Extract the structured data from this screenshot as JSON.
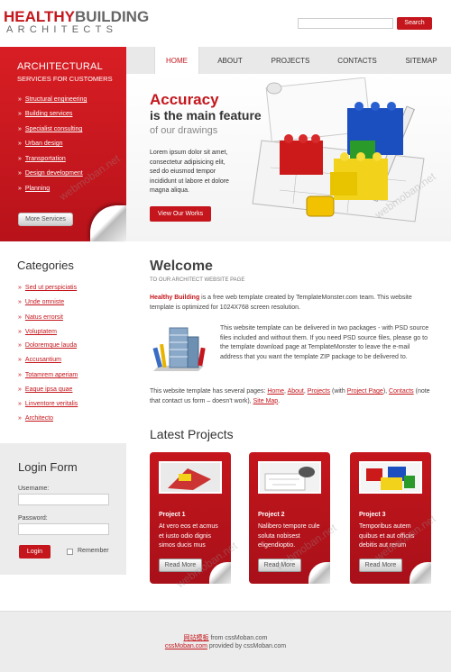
{
  "header": {
    "logo_red": "HEALTHY",
    "logo_grey": "BUILDING",
    "logo_sub": "ARCHITECTS",
    "search_button": "Search",
    "search_value": ""
  },
  "nav": [
    "HOME",
    "ABOUT",
    "PROJECTS",
    "CONTACTS",
    "SITEMAP"
  ],
  "services": {
    "title": "ARCHITECTURAL",
    "subtitle": "SERVICES FOR CUSTOMERS",
    "items": [
      "Structural engineering",
      "Building services",
      "Specialist consulting",
      "Urban design",
      "Transportation",
      "Design development",
      "Planning"
    ],
    "button": "More Services"
  },
  "banner": {
    "line1": "Accuracy",
    "line2": "is the main feature",
    "line3": "of our drawings",
    "text": "Lorem ipsum dolor sit amet, consectetur adipisicing elit, sed do eiusmod tempor incididunt ut labore et dolore magna aliqua.",
    "button": "View Our Works"
  },
  "categories": {
    "title": "Categories",
    "items": [
      "Sed ut perspiciatis",
      "Unde omniste",
      "Natus errorsit",
      "Voluptatem",
      "Doloremque lauda",
      "Accusantium",
      "Totamrem aperiam",
      "Eaque ipsa quae",
      "Linventore veritalis",
      "Architecto"
    ]
  },
  "login": {
    "title": "Login Form",
    "username_label": "Username:",
    "password_label": "Password:",
    "button": "Login",
    "remember": "Remember"
  },
  "welcome": {
    "title": "Welcome",
    "subtitle": "TO OUR ARCHITECT WEBSITE PAGE",
    "p1_bold": "Healthy Building",
    "p1_rest": " is a free web template created by TemplateMonster.com team. This website template is optimized for 1024X768 screen resolution.",
    "p2": "This website template can be delivered in two packages - with PSD source files included and without them. If you need PSD source files, please go to the template download page at TemplateMonster to leave the e-mail address that you want the template ZIP package to be delivered to.",
    "p3_a": "This website template has several pages: ",
    "p3_links": [
      "Home",
      "About",
      "Projects",
      "Project Page",
      "Contacts",
      "Site Map"
    ],
    "p3_with": " (with ",
    "p3_note": " (note that contact us form – doesn't work), "
  },
  "projects": {
    "title": "Latest Projects",
    "button": "Read More",
    "items": [
      {
        "name": "Project 1",
        "text": "At vero eos et acmus et iusto odio dignis simos ducis mus"
      },
      {
        "name": "Project 2",
        "text": "Nalibero tempore cule soluta nobisest eligendioptio."
      },
      {
        "name": "Project 3",
        "text": "Temporibus autem quibus et aut officiis debitis aut rerum"
      }
    ]
  },
  "footer": {
    "line1_link": "网站模板",
    "line1_rest": " from cssMoban.com",
    "line2_link": "cssMoban.com",
    "line2_rest": " provided by cssMoban.com"
  },
  "watermark": "webmoban.net",
  "colors": {
    "accent": "#c4161c",
    "sidebar_bg": "#ececec"
  }
}
